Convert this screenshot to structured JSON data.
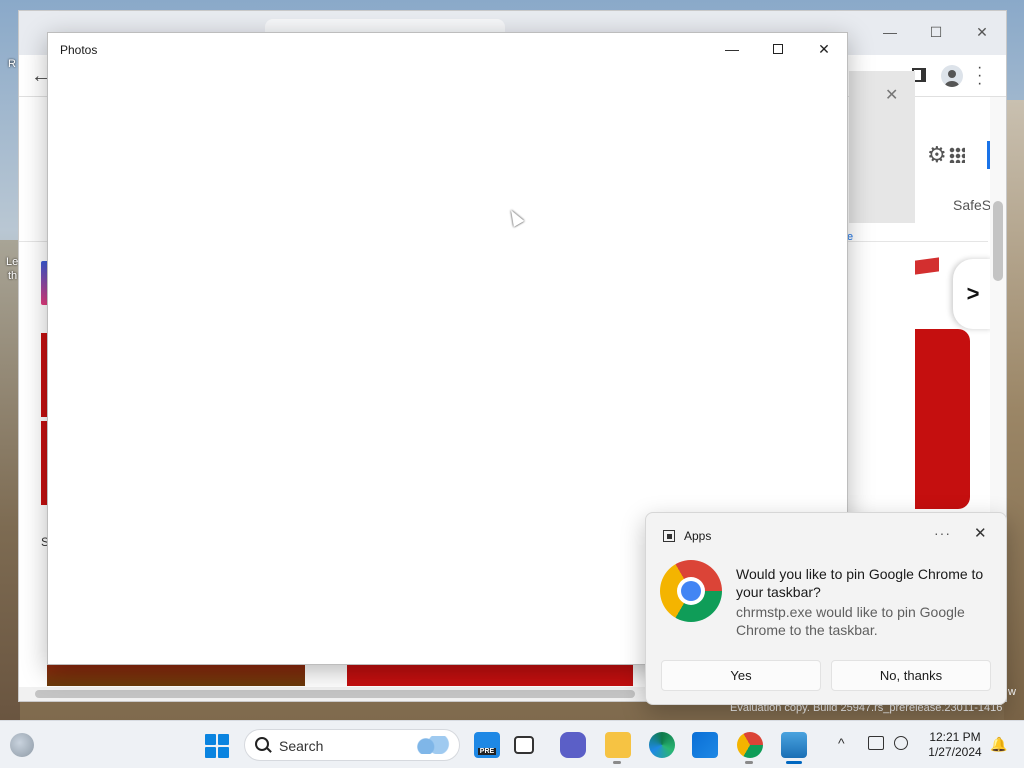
{
  "desktop": {
    "fragments": [
      "R",
      "Le",
      "th"
    ],
    "eval_text": "Evaluation copy. Build 25947.rs_prerelease.23011-1416",
    "right_fragment": "w"
  },
  "chrome": {
    "safes_label": "SafeS",
    "small_e": "e",
    "left_letter": "S",
    "next_label": ">",
    "window_controls": {
      "minimize": "—",
      "maximize": "☐",
      "close": "✕"
    }
  },
  "photos": {
    "title": "Photos",
    "controls": {
      "minimize": "—",
      "close": "✕"
    }
  },
  "toast": {
    "app_name": "Apps",
    "more": "···",
    "close": "✕",
    "heading": "Would you like to pin Google Chrome to your taskbar?",
    "body": "chrmstp.exe would like to pin Google Chrome to the taskbar.",
    "buttons": {
      "yes": "Yes",
      "no": "No, thanks"
    }
  },
  "taskbar": {
    "search_placeholder": "Search",
    "apps": [
      {
        "name": "edge-pre-icon",
        "label": "PRE"
      },
      {
        "name": "file-manager-icon",
        "label": ""
      },
      {
        "name": "meet-icon",
        "label": ""
      },
      {
        "name": "file-explorer-icon",
        "label": ""
      },
      {
        "name": "edge-icon",
        "label": ""
      },
      {
        "name": "store-icon",
        "label": ""
      },
      {
        "name": "chrome-icon",
        "label": ""
      },
      {
        "name": "photos-icon",
        "label": ""
      }
    ],
    "time": "12:21 PM",
    "date": "1/27/2024",
    "colors": {
      "start_blue": "#0a84e0",
      "active_indicator": "#0067c0"
    }
  }
}
